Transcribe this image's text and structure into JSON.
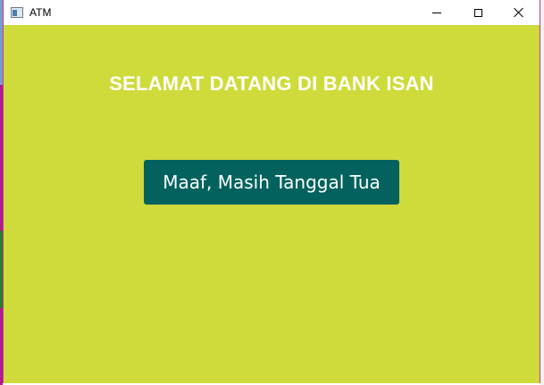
{
  "window": {
    "title": "ATM",
    "controls": [
      "minimize-icon",
      "maximize-icon",
      "close-icon"
    ]
  },
  "main": {
    "heading": "SELAMAT DATANG DI BANK ISAN",
    "button_label": "Maaf, Masih Tanggal Tua"
  },
  "colors": {
    "background": "#cfdb3a",
    "button": "#03625d",
    "text": "#ffffff"
  }
}
